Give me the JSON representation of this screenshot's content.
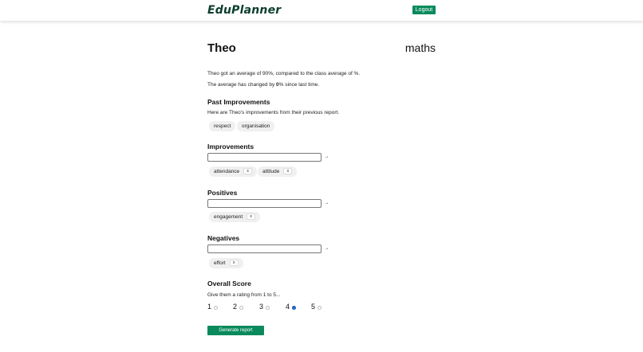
{
  "header": {
    "logo_prefix": "Edu",
    "logo_suffix": "Planner",
    "logout_label": "Logout"
  },
  "student": {
    "name": "Theo",
    "subject": "maths"
  },
  "summary": {
    "line1": "Theo got an average of 90%, compared to the class average of %.",
    "line2_prefix": "The average has changed by ",
    "line2_value": "0",
    "line2_suffix": "% since last time."
  },
  "past_improvements": {
    "heading": "Past Improvements",
    "description": "Here are Theo's improvements from their previous report.",
    "chips": [
      "respect",
      "organisation"
    ]
  },
  "improvements": {
    "heading": "Improvements",
    "input_value": "",
    "add_icon": "arrow-icon",
    "chips": [
      "attendance",
      "attitude"
    ]
  },
  "positives": {
    "heading": "Positives",
    "input_value": "",
    "chips": [
      "engagement"
    ]
  },
  "negatives": {
    "heading": "Negatives",
    "input_value": "",
    "chips": [
      "effort"
    ]
  },
  "overall": {
    "heading": "Overall Score",
    "prompt": "Give them a rating from 1 to 5...",
    "options": [
      "1",
      "2",
      "3",
      "4",
      "5"
    ],
    "selected": "4"
  },
  "chip_remove_label": "x",
  "arrow_glyph": "→",
  "generate_label": "Generate report",
  "colors": {
    "accent": "#0a8a5c",
    "radio_selected": "#2a6fdb"
  }
}
